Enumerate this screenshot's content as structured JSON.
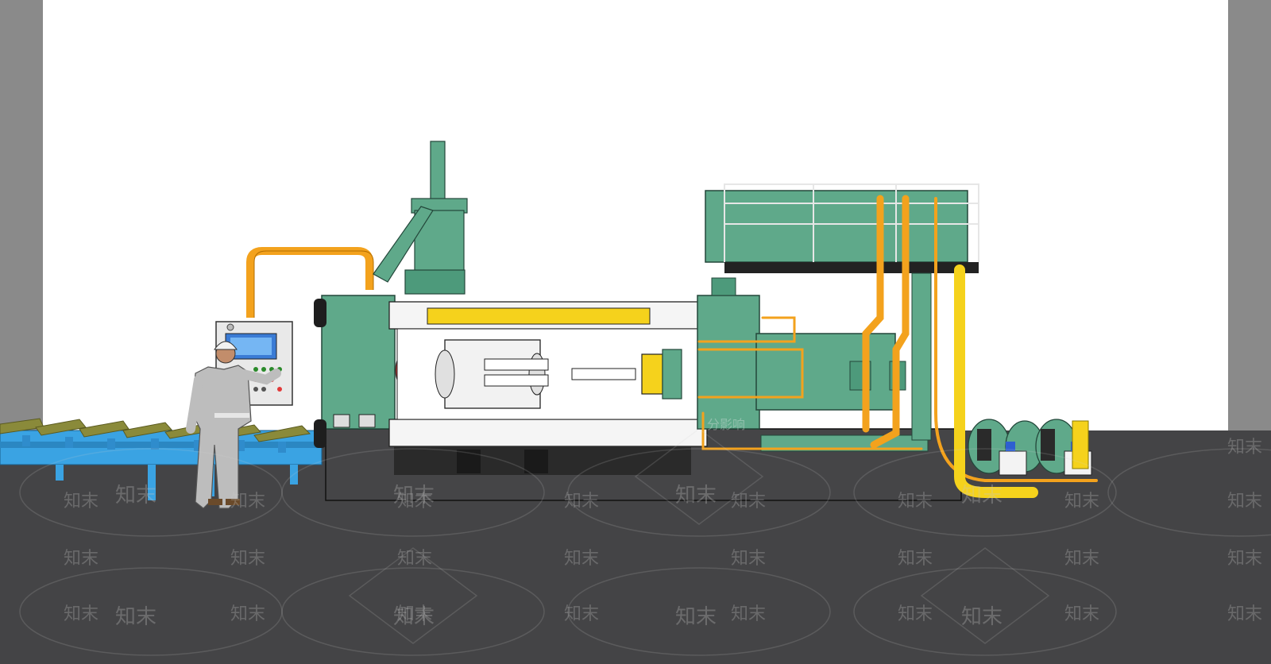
{
  "watermark": {
    "text": "知末",
    "caption": "分影响"
  },
  "colors": {
    "machine_green": "#5fa98a",
    "machine_green_dark": "#3f7f66",
    "pipe_orange": "#f3a21d",
    "pipe_yellow": "#f5d21c",
    "conveyor_blue": "#3aa3e3",
    "floor": "#444446",
    "wall": "#ffffff",
    "accent_red": "#e23a3a"
  },
  "scene": {
    "subject": "extrusion-press-machine",
    "operator": "worker-at-control-panel"
  }
}
